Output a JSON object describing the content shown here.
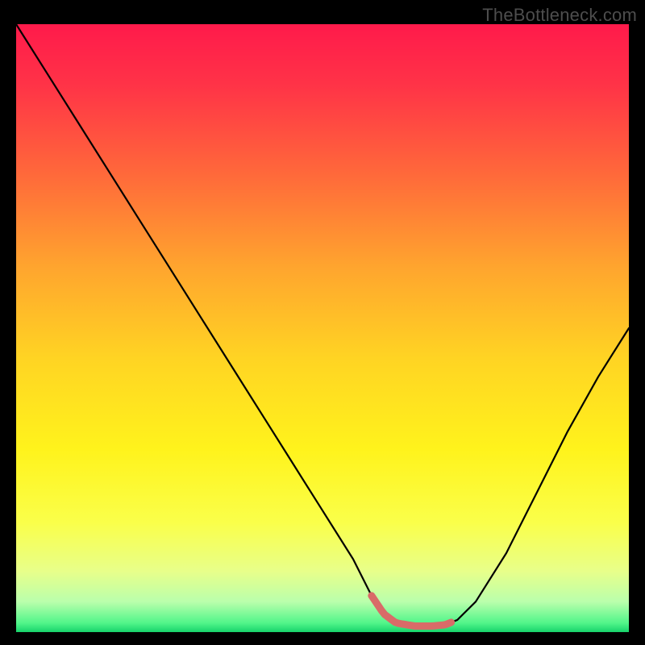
{
  "watermark": "TheBottleneck.com",
  "chart_data": {
    "type": "line",
    "title": "",
    "xlabel": "",
    "ylabel": "",
    "xlim": [
      0,
      100
    ],
    "ylim": [
      0,
      100
    ],
    "grid": false,
    "legend": false,
    "series": [
      {
        "name": "bottleneck-curve",
        "x": [
          0,
          5,
          10,
          15,
          20,
          25,
          30,
          35,
          40,
          45,
          50,
          55,
          58,
          60,
          62,
          65,
          68,
          70,
          72,
          75,
          80,
          85,
          90,
          95,
          100
        ],
        "y": [
          100,
          92,
          84,
          76,
          68,
          60,
          52,
          44,
          36,
          28,
          20,
          12,
          6,
          3,
          1.5,
          1,
          1,
          1.2,
          2,
          5,
          13,
          23,
          33,
          42,
          50
        ]
      }
    ],
    "highlight_region": {
      "name": "optimal-band",
      "x_start": 58,
      "x_end": 71,
      "color": "#d96b68"
    },
    "gradient_stops": [
      {
        "offset": 0.0,
        "color": "#ff1a4b"
      },
      {
        "offset": 0.1,
        "color": "#ff3347"
      },
      {
        "offset": 0.25,
        "color": "#ff6a3a"
      },
      {
        "offset": 0.4,
        "color": "#ffa52e"
      },
      {
        "offset": 0.55,
        "color": "#ffd423"
      },
      {
        "offset": 0.7,
        "color": "#fff31c"
      },
      {
        "offset": 0.82,
        "color": "#faff4a"
      },
      {
        "offset": 0.9,
        "color": "#e8ff8a"
      },
      {
        "offset": 0.95,
        "color": "#baffac"
      },
      {
        "offset": 0.985,
        "color": "#52f58a"
      },
      {
        "offset": 1.0,
        "color": "#17d36b"
      }
    ]
  }
}
